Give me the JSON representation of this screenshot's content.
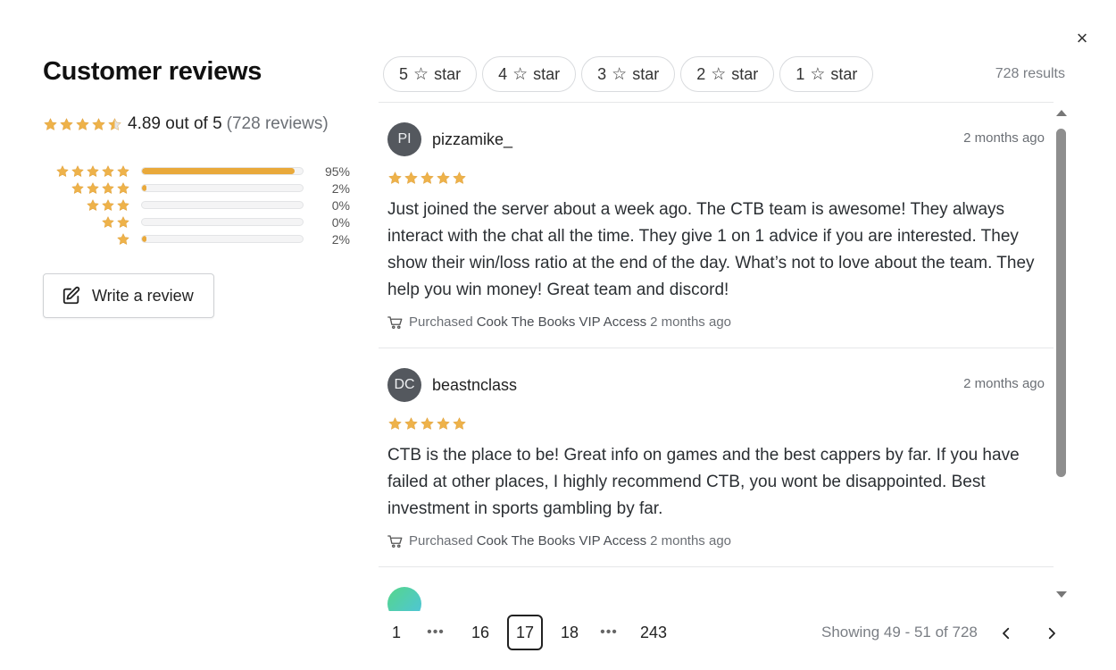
{
  "dialog": {
    "close_label": "×"
  },
  "sidebar": {
    "title": "Customer reviews",
    "average_text": "4.89 out of 5",
    "count_text": "(728 reviews)",
    "average_rating": 4.89,
    "distribution": [
      {
        "stars": 5,
        "fraction": 0.95,
        "label": "95%"
      },
      {
        "stars": 4,
        "fraction": 0.02,
        "label": "2%"
      },
      {
        "stars": 3,
        "fraction": 0.0,
        "label": "0%"
      },
      {
        "stars": 2,
        "fraction": 0.0,
        "label": "0%"
      },
      {
        "stars": 1,
        "fraction": 0.02,
        "label": "2%"
      }
    ],
    "write_review_label": "Write a review"
  },
  "filters": {
    "chips": [
      {
        "num": "5",
        "glyph": "☆",
        "word": "star"
      },
      {
        "num": "4",
        "glyph": "☆",
        "word": "star"
      },
      {
        "num": "3",
        "glyph": "☆",
        "word": "star"
      },
      {
        "num": "2",
        "glyph": "☆",
        "word": "star"
      },
      {
        "num": "1",
        "glyph": "☆",
        "word": "star"
      }
    ],
    "results_text": "728 results"
  },
  "reviews": [
    {
      "initials": "PI",
      "user": "pizzamike_",
      "when": "2 months ago",
      "rating": 5,
      "body": "Just joined the server about a week ago. The CTB team is awesome! They always interact with the chat all the time. They give 1 on 1 advice if you are interested. They show their win/loss ratio at the end of the day. What’s not to love about the team. They help you win money! Great team and discord!",
      "purchased_label": "Purchased",
      "product": "Cook The Books VIP Access",
      "purchased_when": "2 months ago"
    },
    {
      "initials": "DC",
      "user": "beastnclass",
      "when": "2 months ago",
      "rating": 5,
      "body": "CTB is the place to be! Great info on games and the best cappers by far. If you have failed at other places, I highly recommend CTB, you wont be disappointed. Best investment in sports gambling by far.",
      "purchased_label": "Purchased",
      "product": "Cook The Books VIP Access",
      "purchased_when": "2 months ago"
    }
  ],
  "pagination": {
    "pages": [
      "1",
      "•••",
      "16",
      "17",
      "18",
      "•••",
      "243"
    ],
    "current": "17",
    "showing_text": "Showing 49 - 51 of 728"
  },
  "colors": {
    "star": "#eeb24a",
    "star_empty": "#e3e4e6",
    "bar": "#e9a93b"
  },
  "icons": {
    "close": "close-icon",
    "star": "star-icon",
    "pen": "edit-icon",
    "cart": "cart-icon",
    "prev": "chevron-left-icon",
    "next": "chevron-right-icon"
  }
}
